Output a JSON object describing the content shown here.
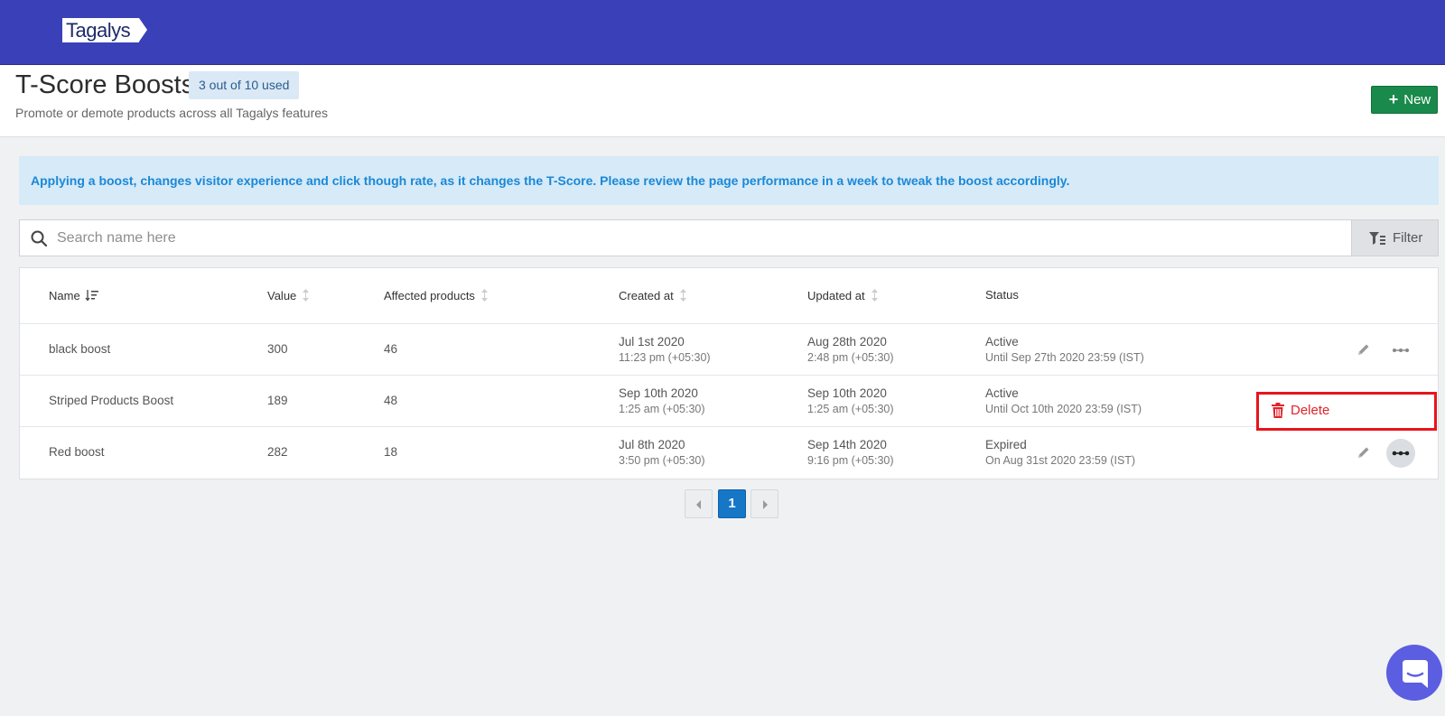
{
  "app": {
    "logo_text": "Tagalys"
  },
  "header": {
    "title": "T-Score Boosts",
    "usage_badge": "3 out of 10 used",
    "subtitle": "Promote or demote products across all Tagalys features",
    "new_button_label": "New"
  },
  "banner": {
    "text": "Applying a boost, changes visitor experience and click though rate, as it changes the T-Score. Please review the page performance in a week to tweak the boost accordingly."
  },
  "search": {
    "placeholder": "Search name here",
    "value": ""
  },
  "filter": {
    "label": "Filter"
  },
  "table": {
    "columns": {
      "name": "Name",
      "value": "Value",
      "affected": "Affected products",
      "created": "Created at",
      "updated": "Updated at",
      "status": "Status"
    },
    "rows": [
      {
        "name": "black boost",
        "value": "300",
        "affected": "46",
        "created_date": "Jul 1st 2020",
        "created_time": "11:23 pm (+05:30)",
        "updated_date": "Aug 28th 2020",
        "updated_time": "2:48 pm (+05:30)",
        "status": "Active",
        "status_detail": "Until Sep 27th 2020 23:59 (IST)"
      },
      {
        "name": "Striped Products Boost",
        "value": "189",
        "affected": "48",
        "created_date": "Sep 10th 2020",
        "created_time": "1:25 am (+05:30)",
        "updated_date": "Sep 10th 2020",
        "updated_time": "1:25 am (+05:30)",
        "status": "Active",
        "status_detail": "Until Oct 10th 2020 23:59 (IST)"
      },
      {
        "name": "Red boost",
        "value": "282",
        "affected": "18",
        "created_date": "Jul 8th 2020",
        "created_time": "3:50 pm (+05:30)",
        "updated_date": "Sep 14th 2020",
        "updated_time": "9:16 pm (+05:30)",
        "status": "Expired",
        "status_detail": "On Aug 31st 2020 23:59 (IST)"
      }
    ]
  },
  "row_menu": {
    "delete_label": "Delete"
  },
  "pagination": {
    "current_page": "1"
  },
  "colors": {
    "topbar": "#3a40b8",
    "new_button": "#198a4b",
    "banner_bg": "#d6eaf7",
    "banner_text": "#1a88d8",
    "delete_red": "#e0242c",
    "pager_active": "#1677c7"
  }
}
